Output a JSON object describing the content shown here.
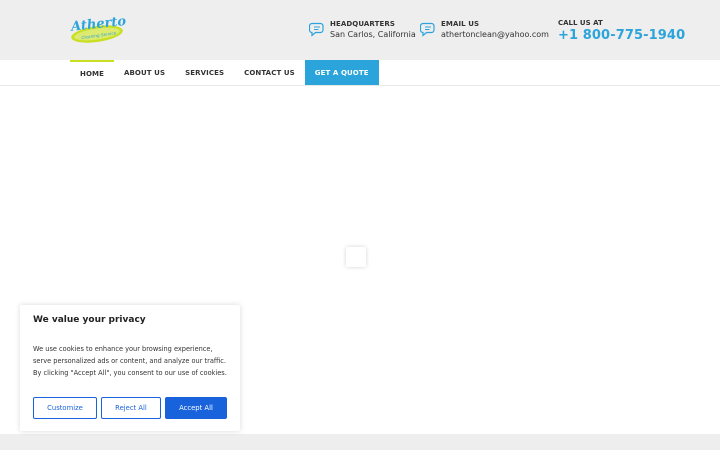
{
  "header": {
    "logo": {
      "text": "Atherton",
      "tagline": "Cleaning Service"
    },
    "headquarters": {
      "label": "HEADQUARTERS",
      "value": "San Carlos, California"
    },
    "email": {
      "label": "EMAIL US",
      "value": "athertonclean@yahoo.com"
    },
    "call": {
      "label": "CALL US AT",
      "phone": "+1 800-775-1940"
    }
  },
  "nav": {
    "items": [
      {
        "label": "HOME"
      },
      {
        "label": "ABOUT US"
      },
      {
        "label": "SERVICES"
      },
      {
        "label": "CONTACT US"
      },
      {
        "label": "GET A QUOTE"
      }
    ]
  },
  "cookie_banner": {
    "title": "We value your privacy",
    "text": "We use cookies to enhance your browsing experience, serve personalized ads or content, and analyze our traffic. By clicking \"Accept All\", you consent to our use of cookies.",
    "customize_label": "Customize",
    "reject_label": "Reject All",
    "accept_label": "Accept All"
  },
  "colors": {
    "accent": "#2ba4dc",
    "nav_active": "#c9df24",
    "cookie_button": "#1863dc"
  },
  "icons": [
    "chat-bubble-icon",
    "chat-bubble-icon"
  ]
}
